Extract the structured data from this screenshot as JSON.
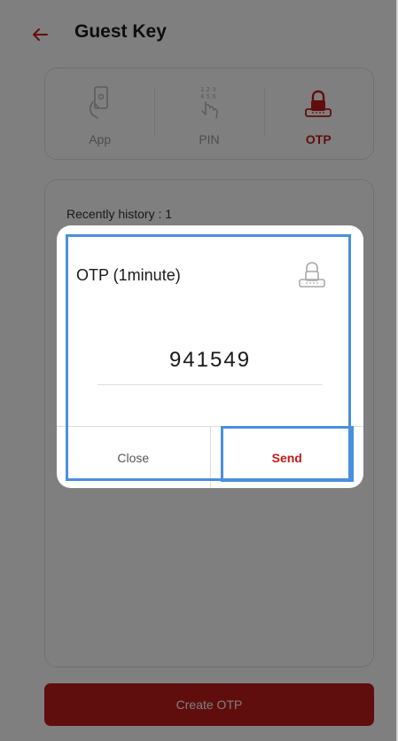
{
  "header": {
    "title": "Guest Key",
    "back_icon": "arrow-left-icon"
  },
  "tabs": [
    {
      "label": "App",
      "icon": "phone-hand-icon",
      "active": false
    },
    {
      "label": "PIN",
      "icon": "keypad-touch-icon",
      "active": false
    },
    {
      "label": "OTP",
      "icon": "lock-icon",
      "active": true
    }
  ],
  "history": {
    "label": "Recently history : 1"
  },
  "footer": {
    "create_label": "Create OTP"
  },
  "dialog": {
    "title": "OTP (1minute)",
    "icon": "lock-icon",
    "code": "941549",
    "close_label": "Close",
    "send_label": "Send"
  },
  "colors": {
    "accent": "#c41a1a",
    "highlight_frame": "#4a8fe0"
  }
}
